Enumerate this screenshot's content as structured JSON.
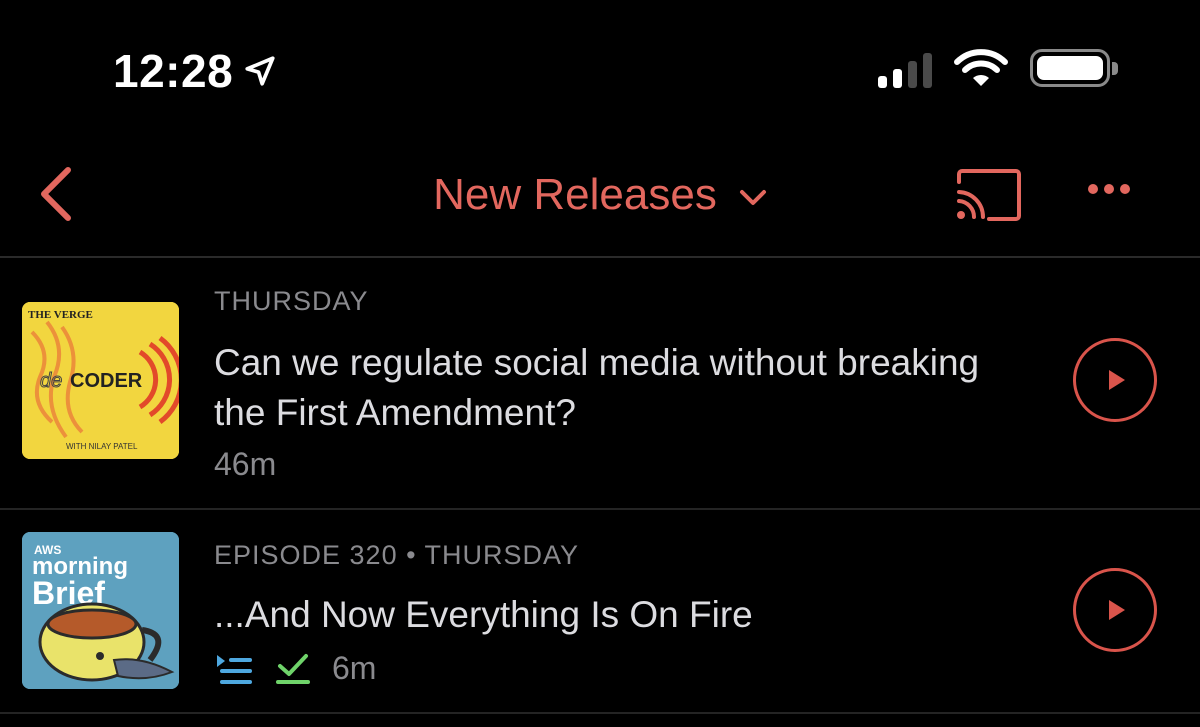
{
  "status_bar": {
    "time": "12:28",
    "icons": [
      "location-arrow-icon",
      "cellular-signal-icon",
      "wifi-icon",
      "battery-icon"
    ]
  },
  "nav": {
    "title": "New Releases",
    "icons": [
      "back-chevron-icon",
      "chevron-down-icon",
      "cast-icon",
      "more-icon"
    ],
    "accent_color": "#e2675e"
  },
  "episodes": [
    {
      "artwork": {
        "brand": "THE VERGE",
        "show": "decoder",
        "show_suffix": "CODER",
        "show_prefix": "de",
        "byline": "WITH NILAY PATEL",
        "bg_color": "#f2d63f"
      },
      "meta": "THURSDAY",
      "title": "Can we regulate social media without breaking the First Amendment?",
      "duration": "46m"
    },
    {
      "artwork": {
        "brand": "AWS",
        "show_line1": "morning",
        "show_line2": "Brief",
        "bg_color": "#5ea1bf"
      },
      "meta": "EPISODE 320 • THURSDAY",
      "title": "...And Now Everything Is On Fire",
      "duration": "6m",
      "status_icons": [
        "queued-icon",
        "downloaded-check-icon"
      ]
    }
  ]
}
